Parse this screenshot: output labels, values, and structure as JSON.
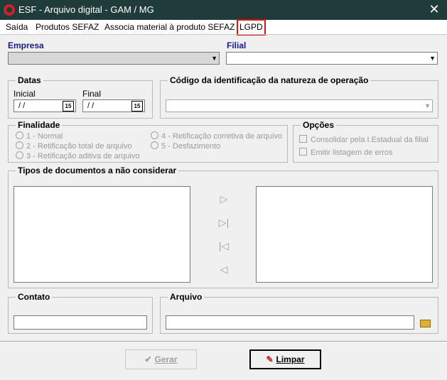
{
  "window": {
    "title": "ESF - Arquivo digital - GAM / MG",
    "close_glyph": "✕"
  },
  "menu": [
    {
      "label": "Saída"
    },
    {
      "label": "Produtos SEFAZ"
    },
    {
      "label": "Associa material à produto SEFAZ"
    },
    {
      "label": "LGPD"
    }
  ],
  "empresa": {
    "label": "Empresa",
    "value": ""
  },
  "filial": {
    "label": "Filial",
    "value": ""
  },
  "datas": {
    "legend": "Datas",
    "inicial_label": "Inicial",
    "final_label": "Final",
    "inicial_value": "/ /",
    "final_value": "/ /",
    "calendar_glyph": "15"
  },
  "natureza": {
    "legend": "Código da identificação da natureza de operação",
    "value": ""
  },
  "finalidade": {
    "legend": "Finalidade",
    "options": [
      "1 - Normal",
      "2 - Retificação total de arquivo",
      "3 - Retificação aditiva de arquivo",
      "4 - Retificação corretiva de arquivo",
      "5 - Desfazimento"
    ]
  },
  "opcoes": {
    "legend": "Opções",
    "items": [
      "Consolidar pela I.Estadual da filial",
      "Emitir listagem de erros"
    ]
  },
  "tipos": {
    "legend": "Tipos de documentos a não considerar",
    "buttons": [
      "▷",
      "▷|",
      "|◁",
      "◁"
    ]
  },
  "contato": {
    "legend": "Contato",
    "value": ""
  },
  "arquivo": {
    "legend": "Arquivo",
    "value": ""
  },
  "actions": {
    "gerar": "Gerar",
    "limpar": "Limpar",
    "gerar_icon": "✔",
    "limpar_icon": "✎"
  }
}
